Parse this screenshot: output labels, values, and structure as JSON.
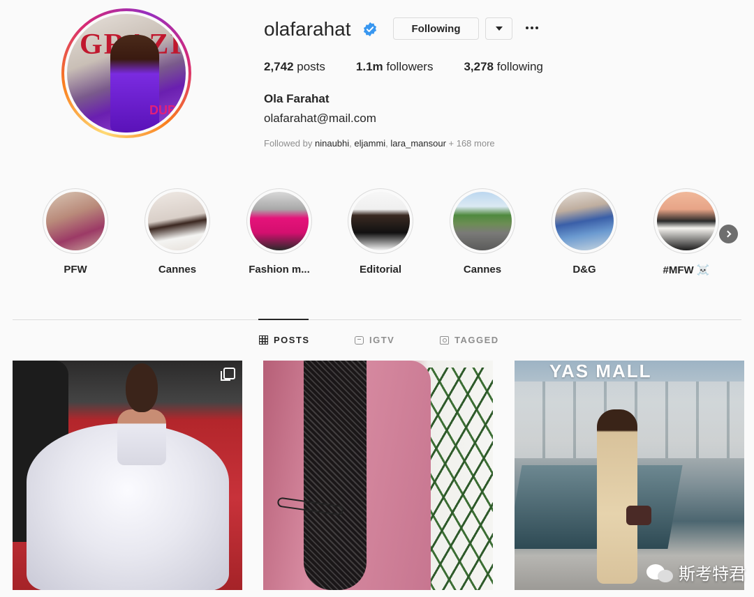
{
  "profile": {
    "username": "olafarahat",
    "following_button": "Following",
    "stats": {
      "posts_count": "2,742",
      "posts_label": " posts",
      "followers_count": "1.1m",
      "followers_label": " followers",
      "following_count": "3,278",
      "following_label": " following"
    },
    "full_name": "Ola Farahat",
    "bio": "olafarahat@mail.com",
    "followed_by": {
      "prefix": "Followed by ",
      "users": [
        "ninaubhi",
        "eljammi",
        "lara_mansour"
      ],
      "separator": ", ",
      "suffix": " + 168 more"
    },
    "avatar_lettering": {
      "magazine": "GRAZIA",
      "overlay": "DUB"
    }
  },
  "highlights": [
    {
      "label": "PFW"
    },
    {
      "label": "Cannes"
    },
    {
      "label": "Fashion m..."
    },
    {
      "label": "Editorial"
    },
    {
      "label": "Cannes"
    },
    {
      "label": "D&G"
    },
    {
      "label": "#MFW ☠️"
    }
  ],
  "tabs": [
    {
      "label": "POSTS",
      "icon": "grid-icon",
      "active": true
    },
    {
      "label": "IGTV",
      "icon": "igtv-icon",
      "active": false
    },
    {
      "label": "TAGGED",
      "icon": "tagged-icon",
      "active": false
    }
  ],
  "posts": [
    {
      "kind": "red-carpet gown",
      "multiple": true
    },
    {
      "kind": "pink blazer",
      "multiple": false
    },
    {
      "kind": "mall",
      "sign": "YAS MALL",
      "multiple": false
    }
  ],
  "watermark": {
    "text": "斯考特君"
  },
  "colors": {
    "verified": "#3897f0",
    "text": "#262626",
    "muted": "#8e8e8e",
    "border": "#dbdbdb"
  }
}
